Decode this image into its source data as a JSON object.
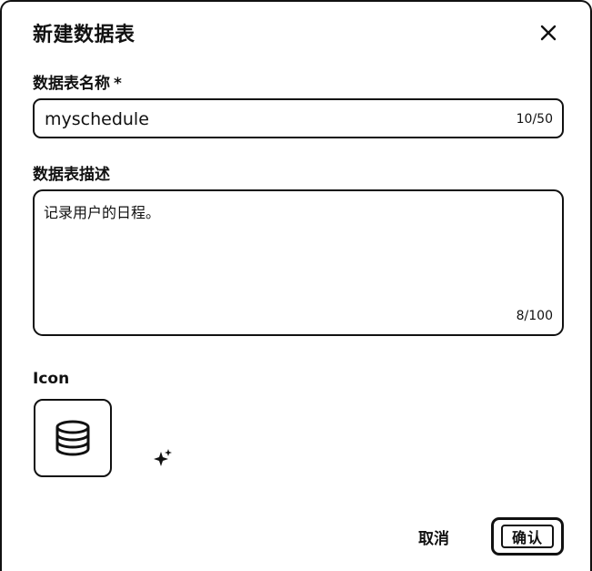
{
  "dialog": {
    "title": "新建数据表",
    "close_icon": "close-icon"
  },
  "name_field": {
    "label": "数据表名称",
    "required_mark": "*",
    "value": "myschedule",
    "counter": "10/50"
  },
  "description_field": {
    "label": "数据表描述",
    "value": "记录用户的日程。",
    "counter": "8/100"
  },
  "icon_field": {
    "label": "Icon",
    "icon": "database-icon",
    "generate_icon": "sparkle-icon"
  },
  "footer": {
    "cancel_label": "取消",
    "confirm_label": "确认"
  }
}
